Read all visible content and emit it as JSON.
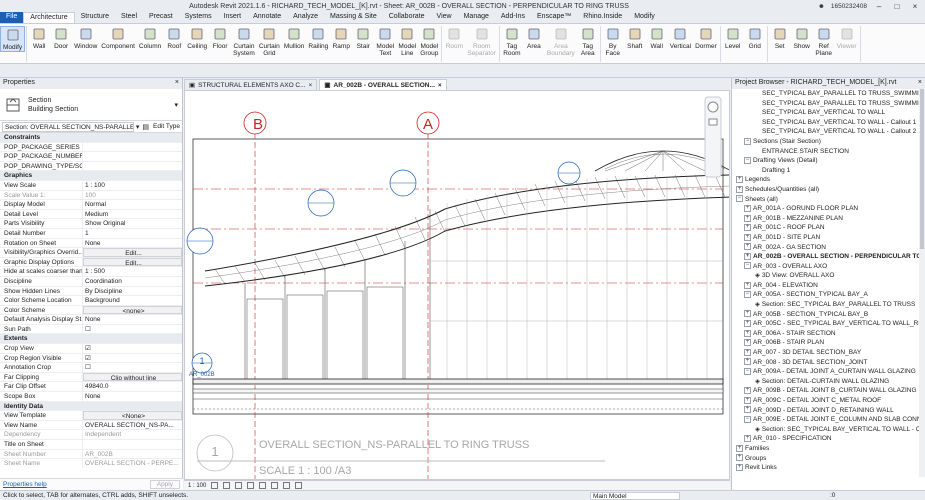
{
  "window": {
    "title": "Autodesk Revit 2021.1.6 - RICHARD_TECH_MODEL_[K].rvt - Sheet: AR_002B - OVERALL SECTION - PERPENDICULAR TO RING TRUSS",
    "user": "1650232408"
  },
  "ribbon_tabs": {
    "file": "File",
    "items": [
      "Architecture",
      "Structure",
      "Steel",
      "Precast",
      "Systems",
      "Insert",
      "Annotate",
      "Analyze",
      "Massing & Site",
      "Collaborate",
      "View",
      "Manage",
      "Add-Ins",
      "Enscape™",
      "Rhino.Inside",
      "Modify"
    ]
  },
  "ribbon_buttons": [
    {
      "label": "Modify",
      "icon": "cursor-icon",
      "active": true
    },
    {
      "label": "Wall",
      "icon": "wall-icon"
    },
    {
      "label": "Door",
      "icon": "door-icon"
    },
    {
      "label": "Window",
      "icon": "window-icon"
    },
    {
      "label": "Component",
      "icon": "component-icon"
    },
    {
      "label": "Column",
      "icon": "column-icon"
    },
    {
      "label": "Roof",
      "icon": "roof-icon"
    },
    {
      "label": "Ceiling",
      "icon": "ceiling-icon"
    },
    {
      "label": "Floor",
      "icon": "floor-icon"
    },
    {
      "label": "Curtain\nSystem",
      "icon": "curtain-system-icon"
    },
    {
      "label": "Curtain\nGrid",
      "icon": "curtain-grid-icon"
    },
    {
      "label": "Mullion",
      "icon": "mullion-icon"
    },
    {
      "label": "Railing",
      "icon": "railing-icon"
    },
    {
      "label": "Ramp",
      "icon": "ramp-icon"
    },
    {
      "label": "Stair",
      "icon": "stair-icon"
    },
    {
      "label": "Model\nText",
      "icon": "model-text-icon"
    },
    {
      "label": "Model\nLine",
      "icon": "model-line-icon"
    },
    {
      "label": "Model\nGroup",
      "icon": "model-group-icon"
    },
    {
      "label": "Room",
      "icon": "room-icon",
      "disabled": true
    },
    {
      "label": "Room\nSeparator",
      "icon": "room-separator-icon",
      "disabled": true
    },
    {
      "label": "Tag\nRoom",
      "icon": "tag-room-icon"
    },
    {
      "label": "Area",
      "icon": "area-icon"
    },
    {
      "label": "Area\nBoundary",
      "icon": "area-boundary-icon",
      "disabled": true
    },
    {
      "label": "Tag\nArea",
      "icon": "tag-area-icon"
    },
    {
      "label": "By\nFace",
      "icon": "by-face-icon"
    },
    {
      "label": "Shaft",
      "icon": "shaft-icon"
    },
    {
      "label": "Wall",
      "icon": "opening-wall-icon"
    },
    {
      "label": "Vertical",
      "icon": "vertical-icon"
    },
    {
      "label": "Dormer",
      "icon": "dormer-icon"
    },
    {
      "label": "Level",
      "icon": "level-icon"
    },
    {
      "label": "Grid",
      "icon": "grid-icon"
    },
    {
      "label": "Set",
      "icon": "set-icon"
    },
    {
      "label": "Show",
      "icon": "show-icon"
    },
    {
      "label": "Ref\nPlane",
      "icon": "ref-plane-icon"
    },
    {
      "label": "Viewer",
      "icon": "viewer-icon",
      "disabled": true
    }
  ],
  "properties": {
    "header": "Properties",
    "type_name_1": "Section",
    "type_name_2": "Building Section",
    "selector": "Section: OVERALL SECTION_NS-PARALLEL TO",
    "edit_type": "Edit Type",
    "rows": [
      {
        "cat": "Constraints"
      },
      {
        "k": "POP_PACKAGE_SERIES",
        "v": ""
      },
      {
        "k": "POP_PACKAGE_NUMBER",
        "v": ""
      },
      {
        "k": "POP_DRAWING_TYPE/SCA...",
        "v": ""
      },
      {
        "cat": "Graphics"
      },
      {
        "k": "View Scale",
        "v": "1 : 100"
      },
      {
        "k": "Scale Value 1:",
        "v": "100",
        "dim": true
      },
      {
        "k": "Display Model",
        "v": "Normal"
      },
      {
        "k": "Detail Level",
        "v": "Medium"
      },
      {
        "k": "Parts Visibility",
        "v": "Show Original"
      },
      {
        "k": "Detail Number",
        "v": "1"
      },
      {
        "k": "Rotation on Sheet",
        "v": "None"
      },
      {
        "k": "Visibility/Graphics Overrid...",
        "v": "Edit...",
        "btn": true
      },
      {
        "k": "Graphic Display Options",
        "v": "Edit...",
        "btn": true
      },
      {
        "k": "Hide at scales coarser than",
        "v": "1 : 500"
      },
      {
        "k": "Discipline",
        "v": "Coordination"
      },
      {
        "k": "Show Hidden Lines",
        "v": "By Discipline"
      },
      {
        "k": "Color Scheme Location",
        "v": "Background"
      },
      {
        "k": "Color Scheme",
        "v": "<none>",
        "btn": true
      },
      {
        "k": "Default Analysis Display St...",
        "v": "None"
      },
      {
        "k": "Sun Path",
        "v": "☐"
      },
      {
        "cat": "Extents"
      },
      {
        "k": "Crop View",
        "v": "☑"
      },
      {
        "k": "Crop Region Visible",
        "v": "☑"
      },
      {
        "k": "Annotation Crop",
        "v": "☐"
      },
      {
        "k": "Far Clipping",
        "v": "Clip without line",
        "btn": true
      },
      {
        "k": "Far Clip Offset",
        "v": "49840.0"
      },
      {
        "k": "Scope Box",
        "v": "None"
      },
      {
        "cat": "Identity Data"
      },
      {
        "k": "View Template",
        "v": "<None>",
        "btn": true
      },
      {
        "k": "View Name",
        "v": "OVERALL SECTION_NS-PA..."
      },
      {
        "k": "Dependency",
        "v": "Independent",
        "dim": true
      },
      {
        "k": "Title on Sheet",
        "v": ""
      },
      {
        "k": "Sheet Number",
        "v": "AR_002B",
        "dim": true
      },
      {
        "k": "Sheet Name",
        "v": "OVERALL SECTION - PERPE...",
        "dim": true
      }
    ],
    "help_link": "Properties help",
    "apply": "Apply"
  },
  "view_tabs": [
    {
      "label": "STRUCTURAL ELEMENTS AXO C..."
    },
    {
      "label": "AR_002B - OVERALL SECTION...",
      "active": true
    }
  ],
  "drawing": {
    "grid_b": "B",
    "grid_a": "A",
    "level_bubble": "1",
    "level_tag": "AR_002B",
    "view_number": "1",
    "view_title": "OVERALL SECTION_NS-PARALLEL TO RING TRUSS",
    "view_scale": "SCALE   1 : 100 /A3"
  },
  "view_bar": {
    "scale": "1 : 100"
  },
  "browser": {
    "header": "Project Browser - RICHARD_TECH_MODEL_[K].rvt",
    "nodes": [
      {
        "t": "SEC_TYPICAL BAY_PARALLEL TO TRUSS_SWIMMING PO",
        "lvl": 2
      },
      {
        "t": "SEC_TYPICAL BAY_PARALLEL TO TRUSS_SWIMMING P",
        "lvl": 2
      },
      {
        "t": "SEC_TYPICAL BAY_VERTICAL TO WALL",
        "lvl": 2
      },
      {
        "t": "SEC_TYPICAL BAY_VERTICAL TO WALL - Callout 1",
        "lvl": 2
      },
      {
        "t": "SEC_TYPICAL BAY_VERTICAL TO WALL - Callout 2",
        "lvl": 2
      },
      {
        "t": "Sections (Stair Section)",
        "lvl": 1,
        "tg": "−"
      },
      {
        "t": "ENTRANCE STAIR SECTION",
        "lvl": 2
      },
      {
        "t": "Drafting Views (Detail)",
        "lvl": 1,
        "tg": "−"
      },
      {
        "t": "Drafting 1",
        "lvl": 2
      },
      {
        "t": "Legends",
        "lvl": 0,
        "tg": "+"
      },
      {
        "t": "Schedules/Quantities (all)",
        "lvl": 0,
        "tg": "+"
      },
      {
        "t": "Sheets (all)",
        "lvl": 0,
        "tg": "−"
      },
      {
        "t": "AR_001A - GORUND FLOOR PLAN",
        "lvl": 1,
        "tg": "+"
      },
      {
        "t": "AR_001B - MEZZANINE PLAN",
        "lvl": 1,
        "tg": "+"
      },
      {
        "t": "AR_001C - ROOF PLAN",
        "lvl": 1,
        "tg": "+"
      },
      {
        "t": "AR_001D - SITE PLAN",
        "lvl": 1,
        "tg": "+"
      },
      {
        "t": "AR_002A - GA SECTION",
        "lvl": 1,
        "tg": "+"
      },
      {
        "t": "AR_002B - OVERALL SECTION - PERPENDICULAR TO RIN",
        "lvl": 1,
        "tg": "+",
        "bold": true
      },
      {
        "t": "AR_003 - OVERALL AXO",
        "lvl": 1,
        "tg": "−"
      },
      {
        "t": "3D View: OVERALL AXO",
        "lvl": 2,
        "icon": true
      },
      {
        "t": "AR_004 - ELEVATION",
        "lvl": 1,
        "tg": "+"
      },
      {
        "t": "AR_005A - SECTION_TYPICAL BAY_A",
        "lvl": 1,
        "tg": "−"
      },
      {
        "t": "Section: SEC_TYPICAL BAY_PARALLEL TO TRUSS",
        "lvl": 2,
        "icon": true
      },
      {
        "t": "AR_005B - SECTION_TYPICAL BAY_B",
        "lvl": 1,
        "tg": "+"
      },
      {
        "t": "AR_005C - SEC_TYPICAL BAY_VERTICAL TO WALL_RETAINI",
        "lvl": 1,
        "tg": "+"
      },
      {
        "t": "AR_006A - STAIR SECTION",
        "lvl": 1,
        "tg": "+"
      },
      {
        "t": "AR_006B - STAIR PLAN",
        "lvl": 1,
        "tg": "+"
      },
      {
        "t": "AR_007 - 3D DETAIL SECTION_BAY",
        "lvl": 1,
        "tg": "+"
      },
      {
        "t": "AR_008 - 3D DETAIL SECTION_JOINT",
        "lvl": 1,
        "tg": "+"
      },
      {
        "t": "AR_009A - DETAIL JOINT A_CURTAIN WALL GLAZING",
        "lvl": 1,
        "tg": "−"
      },
      {
        "t": "Section: DETAIL-CURTAIN WALL GLAZING",
        "lvl": 2,
        "icon": true
      },
      {
        "t": "AR_009B - DETAIL JOINT B_CURTAIN WALL GLAZING",
        "lvl": 1,
        "tg": "+"
      },
      {
        "t": "AR_009C - DETAIL JOINT C_METAL ROOF",
        "lvl": 1,
        "tg": "+"
      },
      {
        "t": "AR_009D - DETAIL JOINT D_RETAINING WALL",
        "lvl": 1,
        "tg": "+"
      },
      {
        "t": "AR_009E - DETAIL JOINT E_COLUMN AND SLAB CONNECT",
        "lvl": 1,
        "tg": "−"
      },
      {
        "t": "Section: SEC_TYPICAL BAY_VERTICAL TO WALL - Call",
        "lvl": 2,
        "icon": true
      },
      {
        "t": "AR_010 - SPECIFICATION",
        "lvl": 1,
        "tg": "+"
      },
      {
        "t": "Families",
        "lvl": 0,
        "tg": "+"
      },
      {
        "t": "Groups",
        "lvl": 0,
        "tg": "+"
      },
      {
        "t": "Revit Links",
        "lvl": 0,
        "tg": "+"
      }
    ]
  },
  "status": {
    "message": "Click to select, TAB for alternates, CTRL adds, SHIFT unselects.",
    "model": "Main Model",
    "zero": ":0"
  },
  "colors": {
    "accent": "#1a5fb4",
    "grid_red": "#cc2020",
    "section_cut": "#d23c3c"
  }
}
